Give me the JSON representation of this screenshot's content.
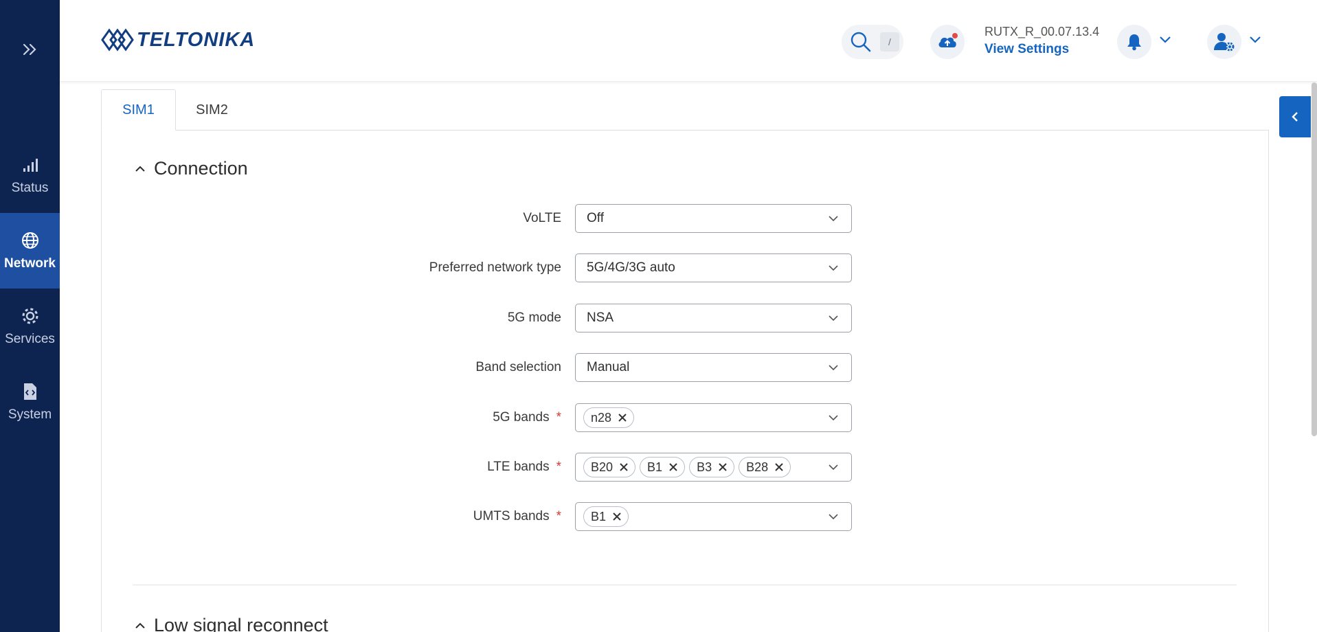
{
  "sidebar": {
    "items": [
      {
        "label": "Status",
        "icon": "signal-bars-icon"
      },
      {
        "label": "Network",
        "icon": "globe-icon"
      },
      {
        "label": "Services",
        "icon": "gear-icon"
      },
      {
        "label": "System",
        "icon": "code-file-icon"
      }
    ],
    "active": "Network"
  },
  "header": {
    "logo_text": "TELTONIKA",
    "search_shortcut": "/",
    "firmware_version": "RUTX_R_00.07.13.4",
    "view_settings_label": "View Settings"
  },
  "tabs": [
    {
      "label": "SIM1",
      "active": true
    },
    {
      "label": "SIM2",
      "active": false
    }
  ],
  "sections": {
    "connection": {
      "title": "Connection",
      "fields": {
        "volte": {
          "label": "VoLTE",
          "value": "Off"
        },
        "network_type": {
          "label": "Preferred network type",
          "value": "5G/4G/3G auto"
        },
        "fiveg_mode": {
          "label": "5G mode",
          "value": "NSA"
        },
        "band_selection": {
          "label": "Band selection",
          "value": "Manual"
        },
        "fiveg_bands": {
          "label": "5G bands",
          "chips": [
            "n28"
          ]
        },
        "lte_bands": {
          "label": "LTE bands",
          "chips": [
            "B20",
            "B1",
            "B3",
            "B28"
          ]
        },
        "umts_bands": {
          "label": "UMTS bands",
          "chips": [
            "B1"
          ]
        }
      }
    },
    "low_signal": {
      "title": "Low signal reconnect"
    }
  },
  "colors": {
    "sidebar_bg": "#0d2451",
    "sidebar_active": "#1f4fa0",
    "accent": "#1565c0",
    "required": "#d63a3a"
  }
}
